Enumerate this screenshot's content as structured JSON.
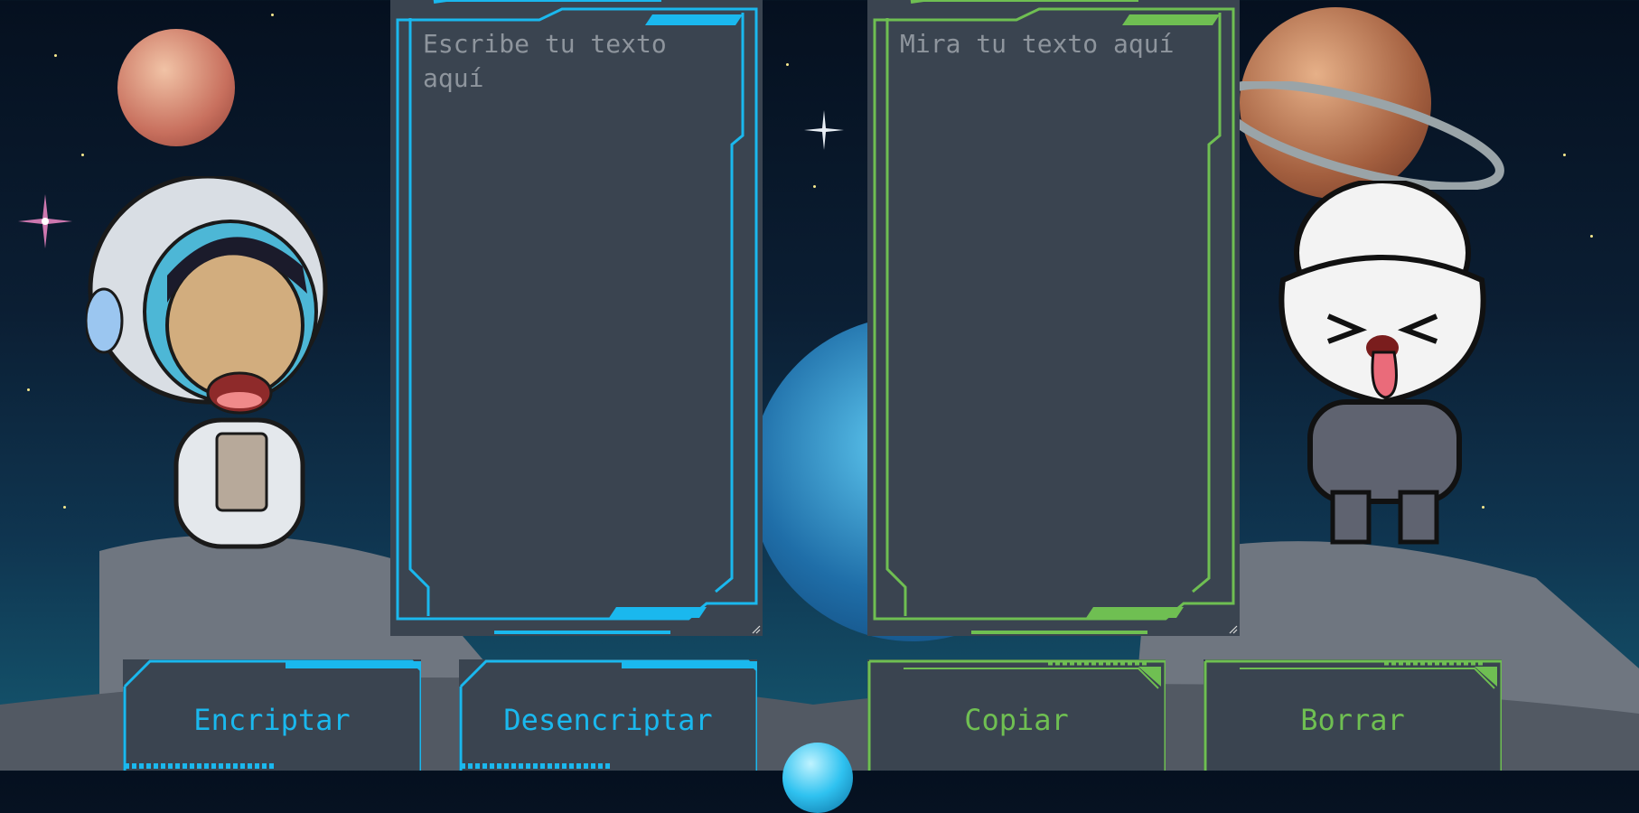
{
  "colors": {
    "encrypt_accent": "#1ab8ee",
    "decrypt_accent": "#6fbf52",
    "panel_bg": "#3a4450"
  },
  "input_panel": {
    "placeholder": "Escribe tu texto aquí",
    "value": ""
  },
  "output_panel": {
    "placeholder": "Mira tu texto aquí",
    "value": ""
  },
  "buttons": {
    "encrypt": "Encriptar",
    "decrypt": "Desencriptar",
    "copy": "Copiar",
    "clear": "Borrar"
  },
  "illustrations": {
    "left_character": "astronaut-child-icon",
    "right_character": "alien-tongue-out-icon"
  }
}
